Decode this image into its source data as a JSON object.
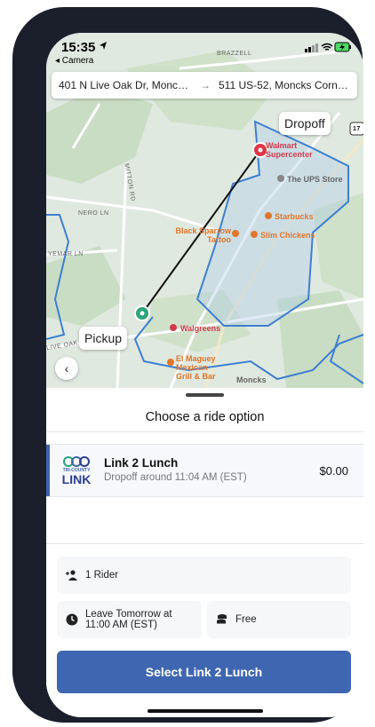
{
  "status_bar": {
    "time": "15:35",
    "back_app_label": "◂ Camera"
  },
  "address": {
    "from": "401 N Live Oak Dr, Monc…",
    "to": "511 US-52, Moncks Corn…"
  },
  "map": {
    "dropoff_label": "Dropoff",
    "pickup_label": "Pickup",
    "pois": {
      "walmart": "Walmart Supercenter",
      "ups": "The UPS Store",
      "starbucks": "Starbucks",
      "black_sparrow": "Black Sparrow Tattoo",
      "slim_chickens": "Slim Chickens",
      "walgreens": "Walgreens",
      "el_maguey": "El Maguey Mexican Grill & Bar",
      "moncks": "Moncks"
    },
    "roads": {
      "brazzell": "BRAZZELL",
      "nero": "NERO LN",
      "mitton": "MITTON RD",
      "yemar": "YEMAR LN",
      "live_oak": "LIVE OAK DR",
      "route_shield": "17"
    }
  },
  "sheet": {
    "title": "Choose a ride option",
    "option": {
      "name": "Link 2 Lunch",
      "dropoff": "Dropoff around 11:04 AM (EST)",
      "price": "$0.00",
      "logo_text_top": "TRI-COUNTY",
      "logo_text_main": "LINK"
    },
    "riders": "1 Rider",
    "leave_line1": "Leave Tomorrow at",
    "leave_line2": "11:00 AM (EST)",
    "fare": "Free",
    "cta": "Select Link 2 Lunch"
  },
  "colors": {
    "accent": "#3f66b1",
    "pickup_pin": "#2aa57a",
    "dropoff_pin": "#e23545",
    "boundary": "#3e7fd1"
  }
}
